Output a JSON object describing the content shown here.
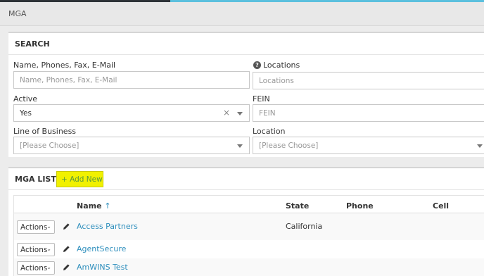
{
  "page": {
    "title": "MGA"
  },
  "search": {
    "title": "SEARCH",
    "name_label": "Name, Phones, Fax, E-Mail",
    "name_placeholder": "Name, Phones, Fax, E-Mail",
    "locations_label": "Locations",
    "locations_placeholder": "Locations",
    "active_label": "Active",
    "active_value": "Yes",
    "fein_label": "FEIN",
    "fein_placeholder": "FEIN",
    "lob_label": "Line of Business",
    "lob_value": "[Please Choose]",
    "location_label": "Location",
    "location_value": "[Please Choose]"
  },
  "list": {
    "title": "MGA LIST",
    "add_new": "+ Add New",
    "columns": {
      "name": "Name",
      "sort_arrow": "↑",
      "state": "State",
      "phone": "Phone",
      "cell": "Cell"
    },
    "actions_label": "Actions",
    "rows": [
      {
        "name": "Access Partners",
        "state": "California",
        "phone": "",
        "cell": ""
      },
      {
        "name": "AgentSecure",
        "state": "",
        "phone": "",
        "cell": ""
      },
      {
        "name": "AmWINS Test",
        "state": "",
        "phone": "",
        "cell": ""
      }
    ]
  },
  "colors": {
    "accent": "#5bc0de",
    "link": "#2f8fbd",
    "highlight": "#f1f100"
  }
}
